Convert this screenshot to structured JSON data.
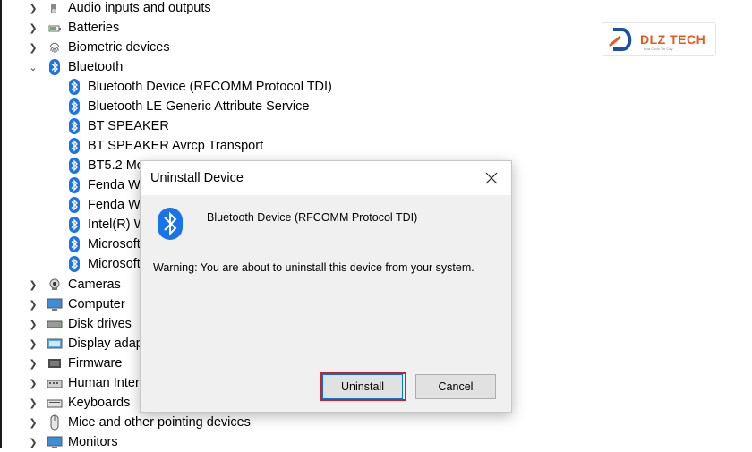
{
  "tree": {
    "categories_top": [
      {
        "label": "Audio inputs and outputs",
        "icon": "speaker-icon"
      },
      {
        "label": "Batteries",
        "icon": "battery-icon"
      },
      {
        "label": "Biometric devices",
        "icon": "fingerprint-icon"
      }
    ],
    "bluetooth": {
      "label": "Bluetooth",
      "children": [
        "Bluetooth Device (RFCOMM Protocol TDI)",
        "Bluetooth LE Generic Attribute Service",
        "BT SPEAKER",
        "BT SPEAKER Avrcp Transport",
        "BT5.2 Mo",
        "Fenda W",
        "Fenda W",
        "Intel(R) W",
        "Microsoft",
        "Microsoft"
      ]
    },
    "categories_bottom": [
      {
        "label": "Cameras",
        "icon": "camera-icon"
      },
      {
        "label": "Computer",
        "icon": "monitor-icon"
      },
      {
        "label": "Disk drives",
        "icon": "disk-drive-icon"
      },
      {
        "label": "Display adap",
        "icon": "display-adapter-icon"
      },
      {
        "label": "Firmware",
        "icon": "firmware-icon"
      },
      {
        "label": "Human Interf",
        "icon": "hid-icon"
      },
      {
        "label": "Keyboards",
        "icon": "keyboard-icon"
      },
      {
        "label": "Mice and other pointing devices",
        "icon": "mouse-icon"
      },
      {
        "label": "Monitors",
        "icon": "monitor-icon"
      }
    ]
  },
  "logo": {
    "text": "DLZ TECH",
    "tagline": "Lựa Chọn Tin Cậy"
  },
  "dialog": {
    "title": "Uninstall Device",
    "device_name": "Bluetooth Device (RFCOMM Protocol TDI)",
    "warning": "Warning: You are about to uninstall this device from your system.",
    "uninstall_label": "Uninstall",
    "cancel_label": "Cancel"
  },
  "colors": {
    "bluetooth_blue": "#1a73e8",
    "highlight_red": "#d11f2a",
    "logo_orange": "#e65a1c"
  }
}
